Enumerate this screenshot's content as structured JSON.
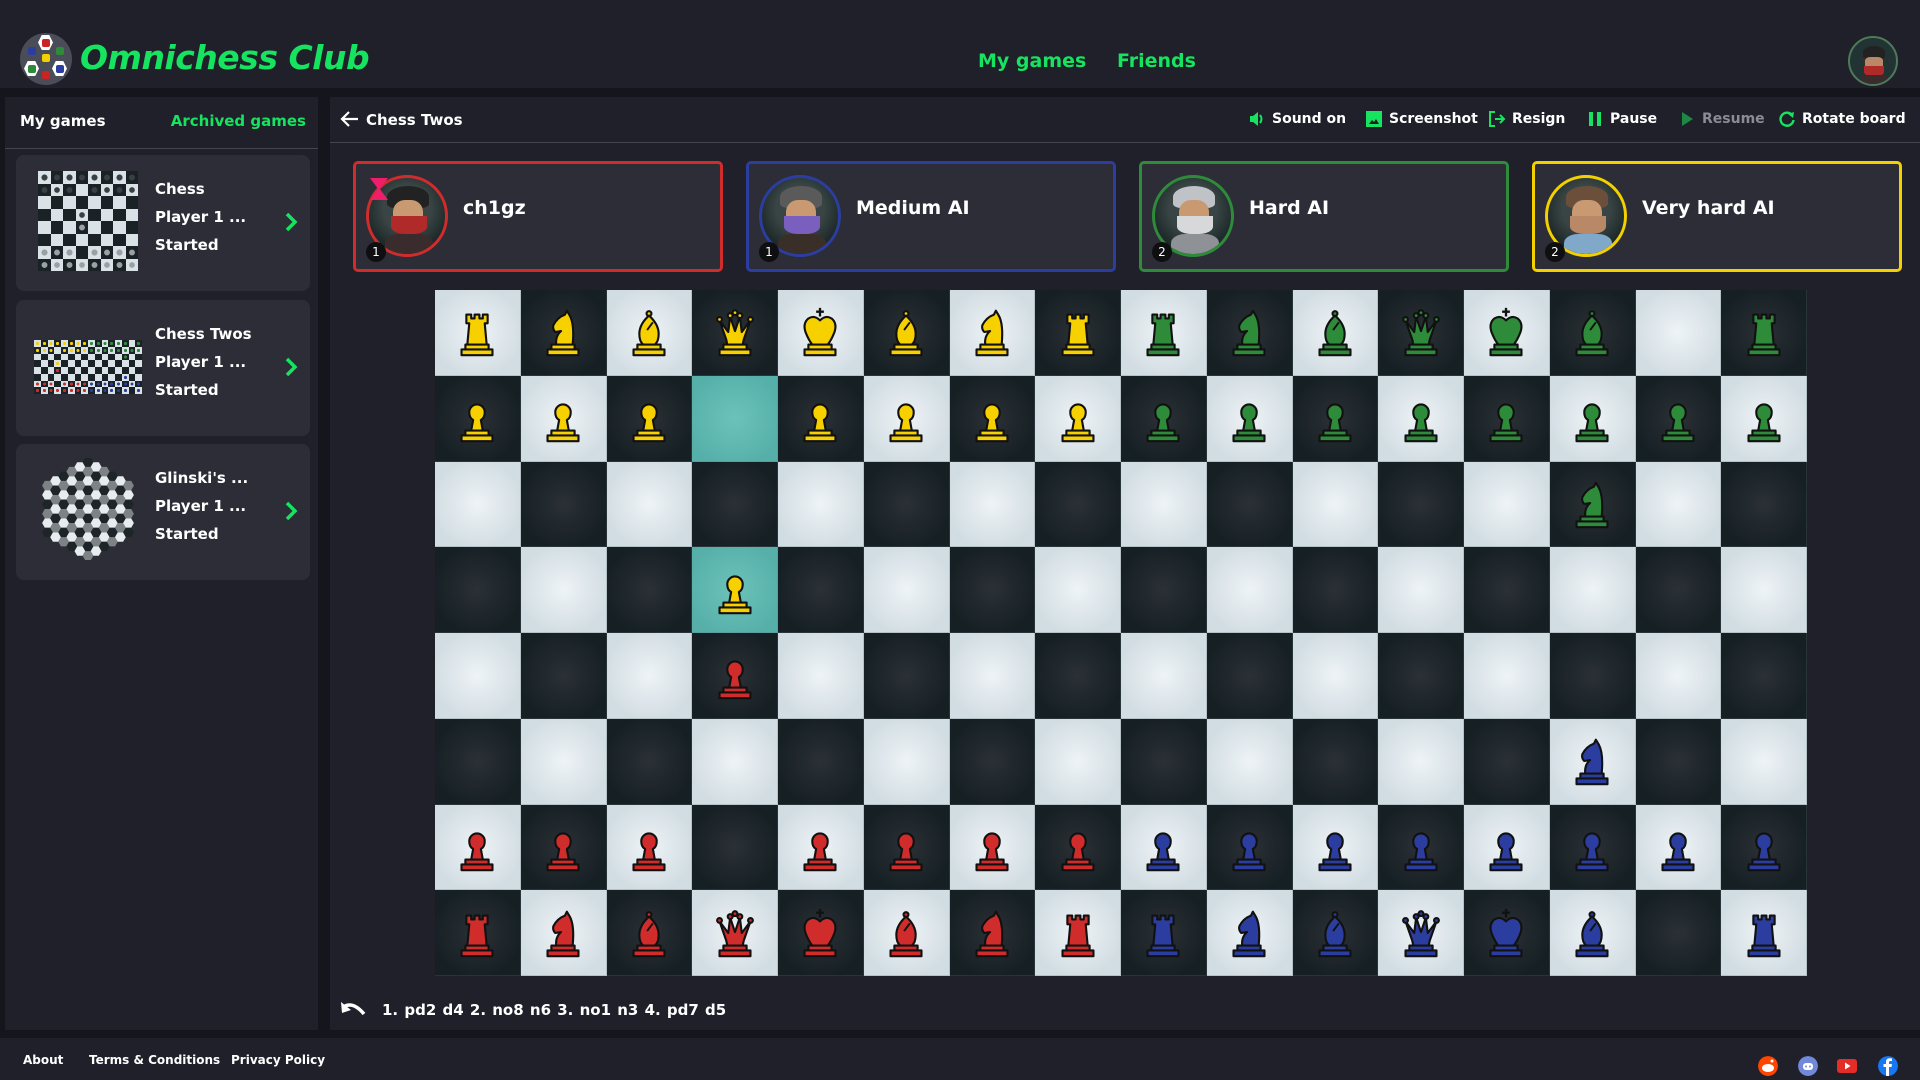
{
  "app": {
    "brand": "Omnichess Club",
    "nav": [
      {
        "label": "My games"
      },
      {
        "label": "Friends"
      }
    ],
    "accent_color": "#16e35f"
  },
  "sidebar": {
    "title": "My games",
    "archived_label": "Archived games",
    "games": [
      {
        "name": "Chess",
        "players": "Player 1 ...",
        "status": "Started",
        "thumbnail": "8x8-board"
      },
      {
        "name": "Chess Twos",
        "players": "Player 1 ...",
        "status": "Started",
        "thumbnail": "16x8-board"
      },
      {
        "name": "Glinski's ...",
        "players": "Player 1 ...",
        "status": "Started",
        "thumbnail": "hexagonal-board"
      }
    ]
  },
  "game": {
    "title": "Chess Twos",
    "toolbar": [
      {
        "label": "Sound on",
        "icon": "speaker-icon",
        "enabled": true
      },
      {
        "label": "Screenshot",
        "icon": "image-icon",
        "enabled": true
      },
      {
        "label": "Resign",
        "icon": "exit-icon",
        "enabled": true
      },
      {
        "label": "Pause",
        "icon": "pause-icon",
        "enabled": true
      },
      {
        "label": "Resume",
        "icon": "play-icon",
        "enabled": false
      },
      {
        "label": "Rotate board",
        "icon": "rotate-icon",
        "enabled": true
      }
    ],
    "players": [
      {
        "name": "ch1gz",
        "team": "1",
        "color": "#d12c2c",
        "current_turn": true
      },
      {
        "name": "Medium AI",
        "team": "1",
        "color": "#2b3ea0",
        "current_turn": false
      },
      {
        "name": "Hard AI",
        "team": "2",
        "color": "#2e8b3a",
        "current_turn": false
      },
      {
        "name": "Very hard AI",
        "team": "2",
        "color": "#f3d000",
        "current_turn": false
      }
    ],
    "piece_colors": {
      "y": "#f7d000",
      "g": "#2e8b3a",
      "r": "#d12c2c",
      "b": "#2b3ea0"
    },
    "board": {
      "columns": 16,
      "rows": 8,
      "ranks": [
        [
          "yR",
          "yN",
          "yB",
          "yQ",
          "yK",
          "yB",
          "yN",
          "yR",
          "gR",
          "gN",
          "gB",
          "gQ",
          "gK",
          "gB",
          "",
          "gR"
        ],
        [
          "yP",
          "yP",
          "yP",
          "",
          "yP",
          "yP",
          "yP",
          "yP",
          "gP",
          "gP",
          "gP",
          "gP",
          "gP",
          "gP",
          "gP",
          "gP"
        ],
        [
          "",
          "",
          "",
          "",
          "",
          "",
          "",
          "",
          "",
          "",
          "",
          "",
          "",
          "gN",
          "",
          ""
        ],
        [
          "",
          "",
          "",
          "yP",
          "",
          "",
          "",
          "",
          "",
          "",
          "",
          "",
          "",
          "",
          "",
          ""
        ],
        [
          "",
          "",
          "",
          "rP",
          "",
          "",
          "",
          "",
          "",
          "",
          "",
          "",
          "",
          "",
          "",
          ""
        ],
        [
          "",
          "",
          "",
          "",
          "",
          "",
          "",
          "",
          "",
          "",
          "",
          "",
          "",
          "bN",
          "",
          ""
        ],
        [
          "rP",
          "rP",
          "rP",
          "",
          "rP",
          "rP",
          "rP",
          "rP",
          "bP",
          "bP",
          "bP",
          "bP",
          "bP",
          "bP",
          "bP",
          "bP"
        ],
        [
          "rR",
          "rN",
          "rB",
          "rQ",
          "rK",
          "rB",
          "rN",
          "rR",
          "bR",
          "bN",
          "bB",
          "bQ",
          "bK",
          "bB",
          "",
          "bR"
        ]
      ],
      "highlighted_squares": [
        [
          1,
          3
        ],
        [
          3,
          3
        ]
      ]
    },
    "moves": "1. pd2 d4  2. no8 n6  3. no1 n3  4. pd7 d5"
  },
  "footer": {
    "links": [
      "About",
      "Terms & Conditions",
      "Privacy Policy"
    ],
    "social": [
      {
        "name": "reddit",
        "color": "#ff4500"
      },
      {
        "name": "discord",
        "color": "#7289da"
      },
      {
        "name": "youtube",
        "color": "#e52d27"
      },
      {
        "name": "facebook",
        "color": "#1877f2"
      }
    ]
  }
}
